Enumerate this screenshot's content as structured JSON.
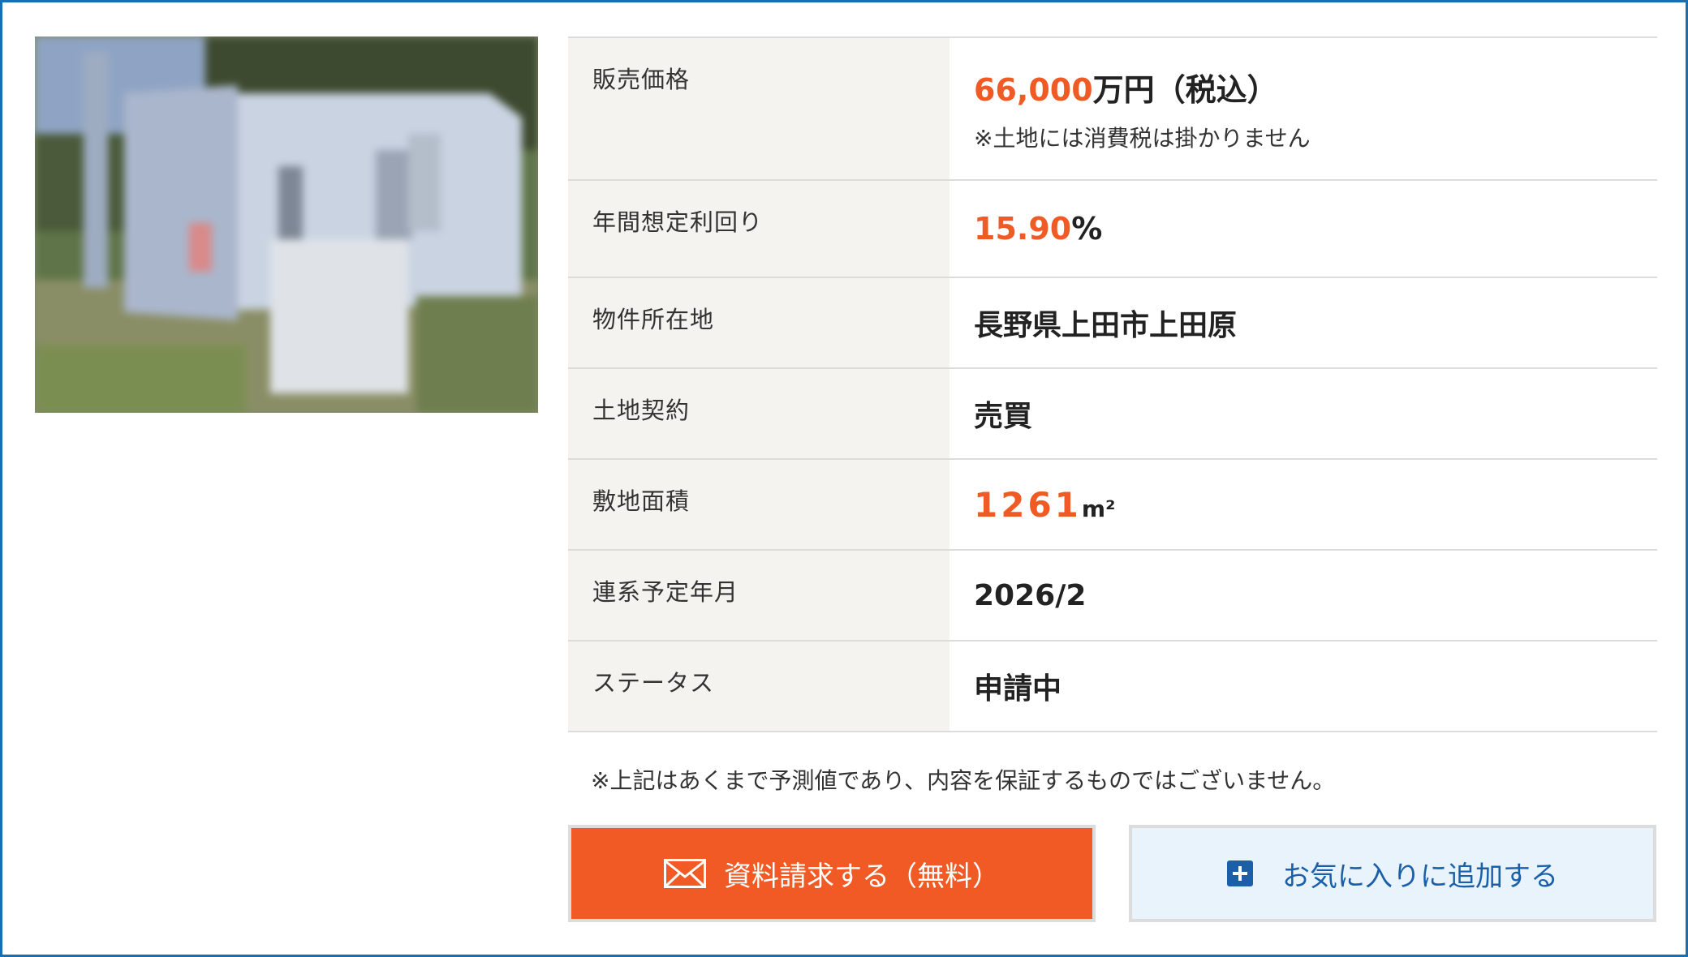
{
  "photo": {
    "alt": "property-photo"
  },
  "spec": {
    "price": {
      "label": "販売価格",
      "amount": "66,000",
      "unit": "万円（税込）",
      "note": "※土地には消費税は掛かりません"
    },
    "yield": {
      "label": "年間想定利回り",
      "value": "15.90",
      "unit": "%"
    },
    "location": {
      "label": "物件所在地",
      "value": "長野県上田市上田原"
    },
    "land_contract": {
      "label": "土地契約",
      "value": "売買"
    },
    "area": {
      "label": "敷地面積",
      "value": "1261",
      "unit": "m²"
    },
    "grid_connection": {
      "label": "連系予定年月",
      "value": "2026/2"
    },
    "status": {
      "label": "ステータス",
      "value": "申請中"
    }
  },
  "disclaimer": "※上記はあくまで予測値であり、内容を保証するものではございません。",
  "buttons": {
    "request": {
      "label": "資料請求する（無料）",
      "icon": "mail-icon"
    },
    "favorite": {
      "label": "お気に入りに追加する",
      "icon": "plus-icon"
    }
  },
  "colors": {
    "accent": "#f05a24",
    "frame": "#1a6fb3",
    "fav_text": "#1b5fa8",
    "fav_bg": "#e8f3fc"
  }
}
